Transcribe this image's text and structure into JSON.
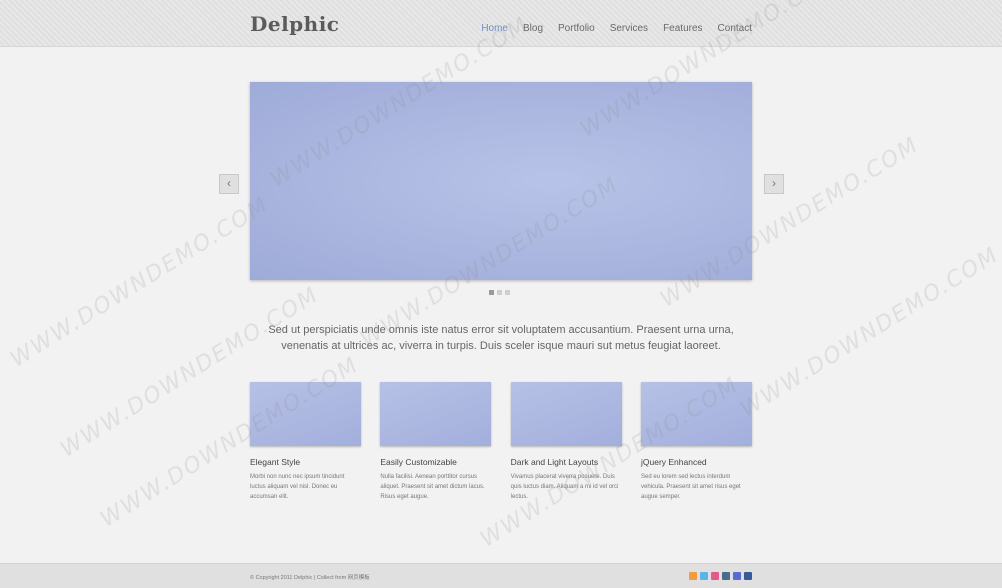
{
  "header": {
    "logo": "Delphic",
    "nav": [
      "Home",
      "Blog",
      "Portfolio",
      "Services",
      "Features",
      "Contact"
    ]
  },
  "slider": {
    "prev_label": "‹",
    "next_label": "›"
  },
  "intro": "Sed ut perspiciatis unde omnis iste natus error sit voluptatem accusantium. Praesent urna urna, venenatis at ultrices ac, viverra in turpis. Duis sceler isque mauri sut metus feugiat laoreet.",
  "features": [
    {
      "title": "Elegant Style",
      "desc": "Morbi non nunc nec ipsum tincidunt luctus aliquam vel nisl. Donec eu accumsan elit."
    },
    {
      "title": "Easily Customizable",
      "desc": "Nulla facilisi. Aenean porttitor cursus aliquet. Praesent sit amet dictum lacus. Risus eget augue."
    },
    {
      "title": "Dark and Light Layouts",
      "desc": "Vivamus placerat viverra posuere. Duis quis luctus diam. Aliquam a mi id vel orci lectus."
    },
    {
      "title": "jQuery Enhanced",
      "desc": "Sed eu lorem sed lectus interdum vehicula. Praesent sit amet risus eget augue semper."
    }
  ],
  "footer": {
    "copyright": "© Copyright 2011 Delphic | Collect from 网页模板"
  },
  "social_icons": [
    {
      "name": "rss-icon",
      "color": "#f29a3c"
    },
    {
      "name": "twitter-icon",
      "color": "#5fb3e3"
    },
    {
      "name": "flickr-icon",
      "color": "#e05a8a"
    },
    {
      "name": "tumblr-icon",
      "color": "#4a6a8c"
    },
    {
      "name": "delicious-icon",
      "color": "#5a6ad0"
    },
    {
      "name": "facebook-icon",
      "color": "#3b5a98"
    }
  ],
  "watermark": "WWW.DOWNDEMO.COM"
}
